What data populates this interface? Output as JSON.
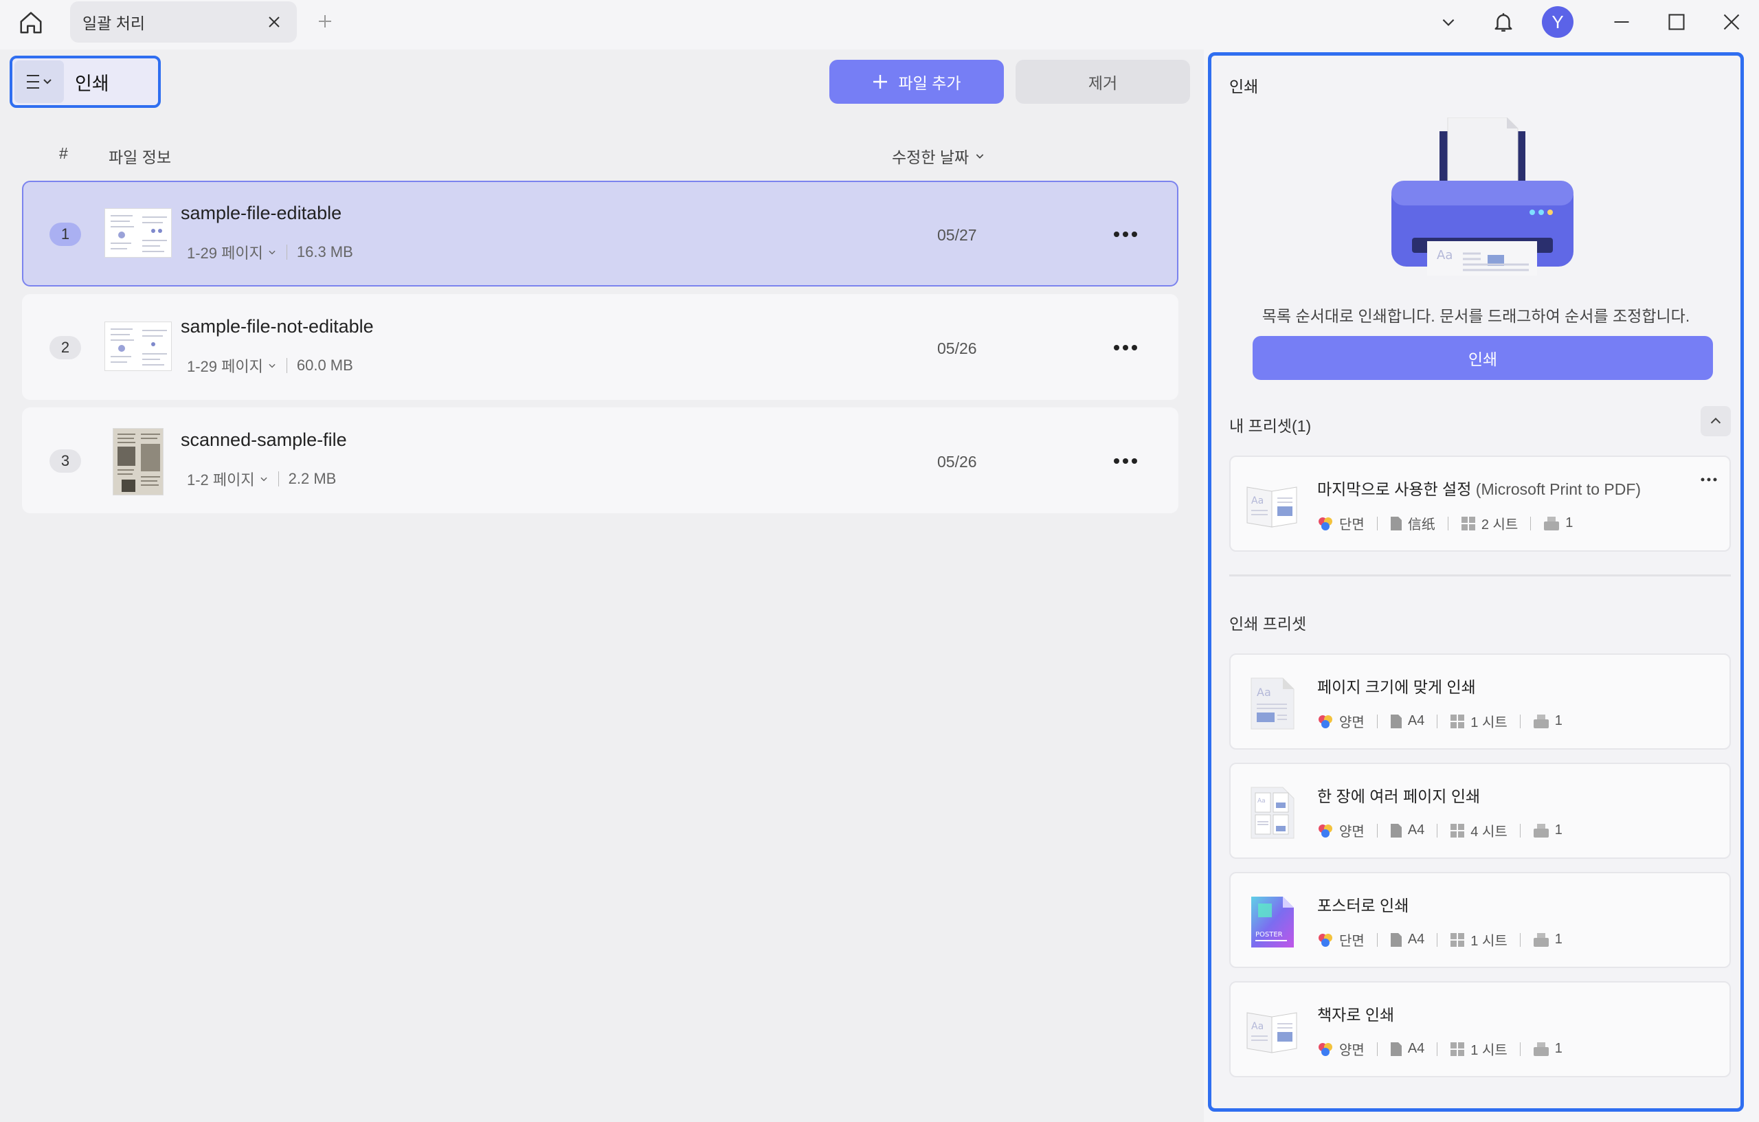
{
  "titlebar": {
    "tab_label": "일괄 처리",
    "avatar_letter": "Y"
  },
  "toolbar": {
    "mode_label": "인쇄",
    "add_file_label": "파일 추가",
    "remove_label": "제거"
  },
  "list": {
    "col_num": "#",
    "col_info": "파일 정보",
    "col_date": "수정한 날짜",
    "files": [
      {
        "num": "1",
        "name": "sample-file-editable",
        "pages": "1-29 페이지",
        "size": "16.3 MB",
        "date": "05/27"
      },
      {
        "num": "2",
        "name": "sample-file-not-editable",
        "pages": "1-29 페이지",
        "size": "60.0 MB",
        "date": "05/26"
      },
      {
        "num": "3",
        "name": "scanned-sample-file",
        "pages": "1-2 페이지",
        "size": "2.2 MB",
        "date": "05/26"
      }
    ]
  },
  "panel": {
    "title": "인쇄",
    "description": "목록 순서대로 인쇄합니다. 문서를 드래그하여 순서를 조정합니다.",
    "print_button": "인쇄",
    "my_presets_title": "내 프리셋(1)",
    "print_presets_title": "인쇄 프리셋",
    "my_presets": [
      {
        "title": "마지막으로 사용한 설정",
        "printer": "(Microsoft Print to PDF)",
        "sides": "단면",
        "paper": "信纸",
        "sheets": "2 시트",
        "copies": "1"
      }
    ],
    "presets": [
      {
        "title": "페이지 크기에 맞게 인쇄",
        "sides": "양면",
        "paper": "A4",
        "sheets": "1 시트",
        "copies": "1"
      },
      {
        "title": "한 장에 여러 페이지 인쇄",
        "sides": "양면",
        "paper": "A4",
        "sheets": "4 시트",
        "copies": "1"
      },
      {
        "title": "포스터로 인쇄",
        "sides": "단면",
        "paper": "A4",
        "sheets": "1 시트",
        "copies": "1"
      },
      {
        "title": "책자로 인쇄",
        "sides": "양면",
        "paper": "A4",
        "sheets": "1 시트",
        "copies": "1"
      }
    ],
    "poster_icon_text": "POSTER"
  },
  "colors": {
    "accent": "#767ef5",
    "focus_border": "#2f6ef0",
    "selected_row": "#d3d5f3"
  }
}
